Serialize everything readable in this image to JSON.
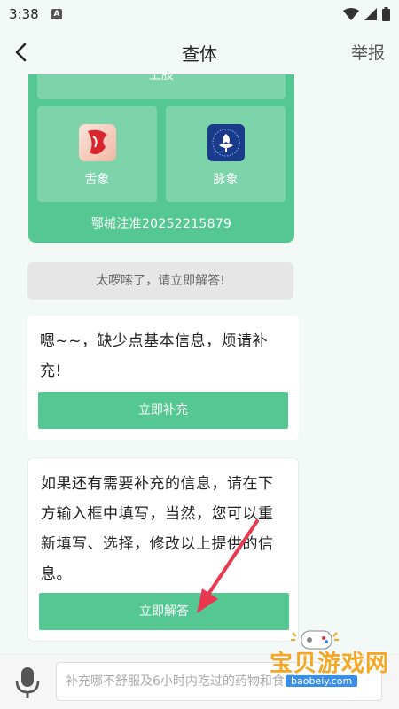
{
  "status_bar": {
    "time": "3:38",
    "notif_glyph": "A",
    "icons": [
      "wifi-icon",
      "signal-icon",
      "battery-icon"
    ]
  },
  "nav": {
    "title": "查体",
    "report_label": "举报",
    "back_icon": "chevron-left-icon"
  },
  "green_card": {
    "top_tile_label": "上肢",
    "tiles": [
      {
        "label": "舌象",
        "icon": "tongue-icon"
      },
      {
        "label": "脉象",
        "icon": "pulse-icon"
      }
    ],
    "cert_text": "鄂械注准20252215879"
  },
  "quick_reply": {
    "label": "太啰嗦了，请立即解答!"
  },
  "messages": [
    {
      "text": "嗯~~，缺少点基本信息，烦请补充!",
      "button_label": "立即补充"
    },
    {
      "text": "如果还有需要补充的信息，请在下方输入框中填写，当然，您可以重新填写、选择，修改以上提供的信息。",
      "button_label": "立即解答"
    }
  ],
  "input": {
    "placeholder": "补充哪不舒服及6小时内吃过的药物和食品",
    "value": ""
  },
  "watermark": {
    "text": "宝贝游戏网",
    "url": "baobeiy.com"
  },
  "colors": {
    "accent": "#55c792",
    "tile": "#7dd3aa",
    "background": "#f2f9f7",
    "arrow": "#e8384f"
  }
}
